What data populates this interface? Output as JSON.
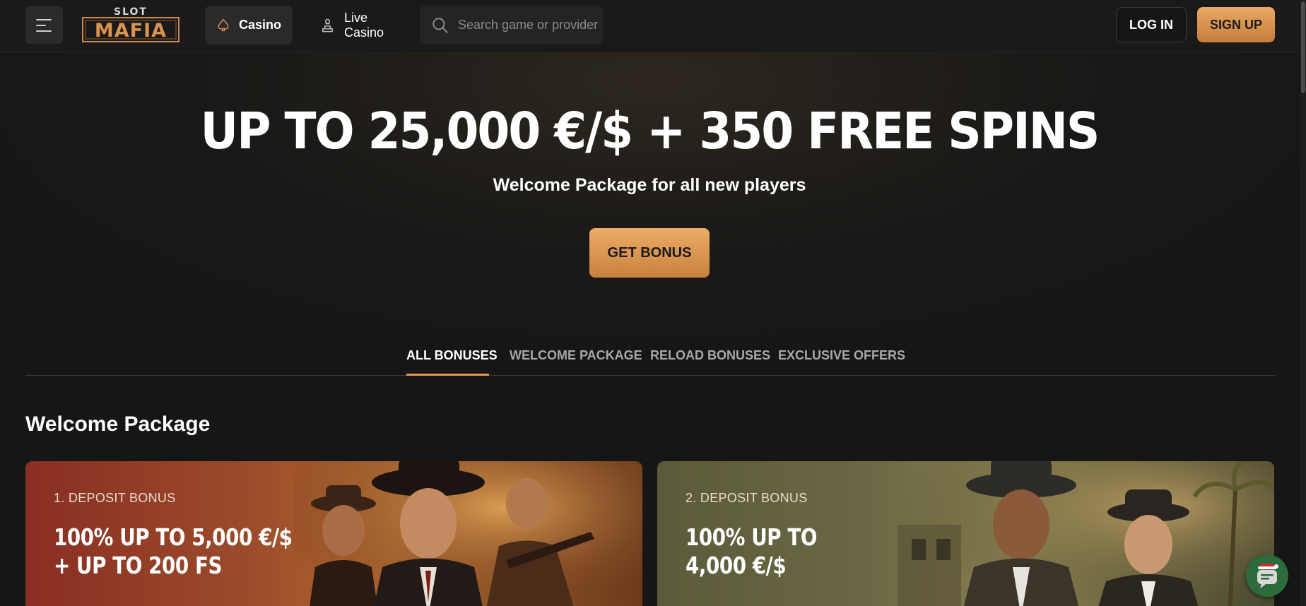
{
  "header": {
    "logo_top": "SLOT",
    "logo_main": "MAFIA",
    "nav": [
      {
        "label": "Casino",
        "icon": "spade-icon"
      },
      {
        "label": "Live Casino",
        "icon": "dealer-icon"
      }
    ],
    "search_placeholder": "Search game or provider",
    "login_label": "LOG IN",
    "signup_label": "SIGN UP"
  },
  "hero": {
    "title": "UP TO 25,000 €/$ + 350 FREE SPINS",
    "subtitle": "Welcome Package for all new players",
    "cta_label": "GET BONUS"
  },
  "tabs": [
    {
      "label": "ALL BONUSES",
      "active": true
    },
    {
      "label": "WELCOME PACKAGE",
      "active": false
    },
    {
      "label": "RELOAD BONUSES",
      "active": false
    },
    {
      "label": "EXCLUSIVE OFFERS",
      "active": false
    }
  ],
  "section": {
    "title": "Welcome Package"
  },
  "cards": [
    {
      "label": "1. DEPOSIT BONUS",
      "offer_line1": "100% UP TO 5,000 €/$",
      "offer_line2": "+ UP TO 200 FS"
    },
    {
      "label": "2. DEPOSIT BONUS",
      "offer_line1": "100% UP TO",
      "offer_line2": "4,000 €/$"
    }
  ],
  "colors": {
    "background": "#161616",
    "header": "#1a1a1a",
    "accent": "#e09a55",
    "accent_gradient_top": "#eaa862",
    "accent_gradient_bottom": "#c57f3c",
    "tab_inactive": "#a8a8a8",
    "chat_button": "#2e6b3a"
  }
}
